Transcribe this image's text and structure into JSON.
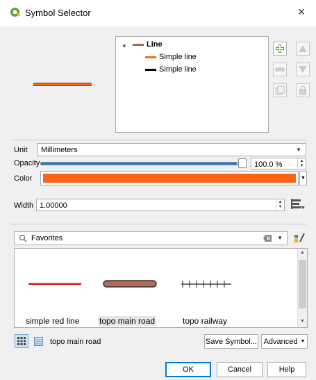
{
  "window": {
    "title": "Symbol Selector",
    "close_glyph": "×"
  },
  "layer_tree": {
    "root": {
      "label": "Line",
      "swatch_color": "#a86a4e"
    },
    "children": [
      {
        "label": "Simple line",
        "swatch_color": "#f26a1b"
      },
      {
        "label": "Simple line",
        "swatch_color": "#000000"
      }
    ]
  },
  "side_buttons": [
    "add-layer-icon",
    "move-up-icon",
    "remove-layer-icon",
    "move-down-icon",
    "duplicate-layer-icon",
    "lock-icon"
  ],
  "unit": {
    "label": "Unit",
    "value": "Millimeters"
  },
  "opacity": {
    "label": "Opacity",
    "value": 1.0,
    "display": "100.0 %"
  },
  "color": {
    "label": "Color",
    "value": "#ff6215"
  },
  "width": {
    "label": "Width",
    "value": "1.00000"
  },
  "search": {
    "value": "Favorites"
  },
  "symbols": [
    {
      "name": "simple red line",
      "selected": false
    },
    {
      "name": "topo main road",
      "selected": true
    },
    {
      "name": "topo railway",
      "selected": false
    }
  ],
  "current_symbol": "topo main road",
  "buttons": {
    "save_symbol": "Save Symbol...",
    "advanced": "Advanced",
    "ok": "OK",
    "cancel": "Cancel",
    "help": "Help"
  },
  "colors": {
    "accent": "#1e7fd8",
    "red_line": "#cc1f1f",
    "road_fill": "#b06a56",
    "road_outline": "#333333"
  }
}
